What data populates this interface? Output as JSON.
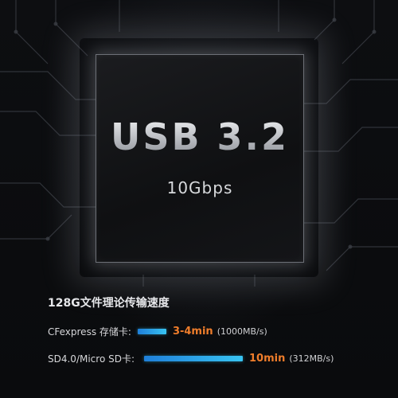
{
  "chip": {
    "title": "USB 3.2",
    "speed": "10Gbps"
  },
  "section": {
    "title": "128G文件理论传输速度"
  },
  "rows": [
    {
      "label": "CFexpress 存储卡:",
      "time": "3-4min",
      "rate": "(1000MB/s)",
      "bar_color": "#2fa9ea"
    },
    {
      "label": "SD4.0/Micro SD卡:",
      "time": "10min",
      "rate": "(312MB/s)",
      "bar_color": "#2fa9ea"
    }
  ],
  "colors": {
    "accent_time": "#ef7d2b",
    "bar_start": "#1f7fd9",
    "bar_end": "#38c4f2"
  }
}
